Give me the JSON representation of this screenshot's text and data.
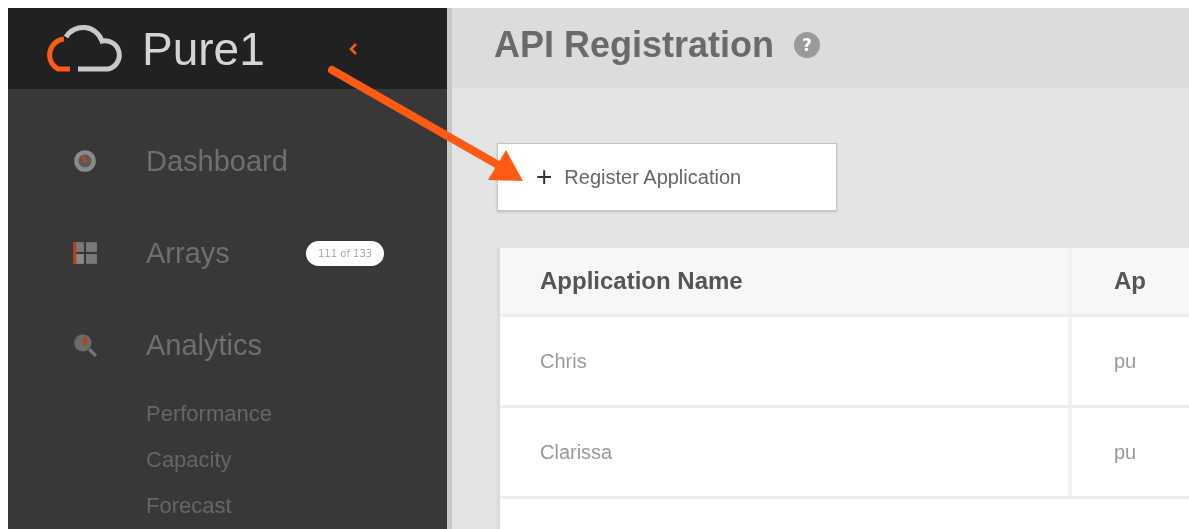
{
  "brand": {
    "name": "Pure1"
  },
  "sidebar": {
    "items": [
      {
        "label": "Dashboard",
        "kind": "dashboard"
      },
      {
        "label": "Arrays",
        "kind": "arrays",
        "badge": "111 of 133"
      },
      {
        "label": "Analytics",
        "kind": "analytics",
        "children": [
          {
            "label": "Performance"
          },
          {
            "label": "Capacity"
          },
          {
            "label": "Forecast"
          }
        ]
      }
    ]
  },
  "page": {
    "title": "API Registration",
    "help": "?"
  },
  "register_button": {
    "icon": "+",
    "label": "Register Application"
  },
  "table": {
    "columns": [
      "Application Name",
      "Ap"
    ],
    "rows": [
      [
        "Chris",
        "pu"
      ],
      [
        "Clarissa",
        "pu"
      ]
    ]
  }
}
